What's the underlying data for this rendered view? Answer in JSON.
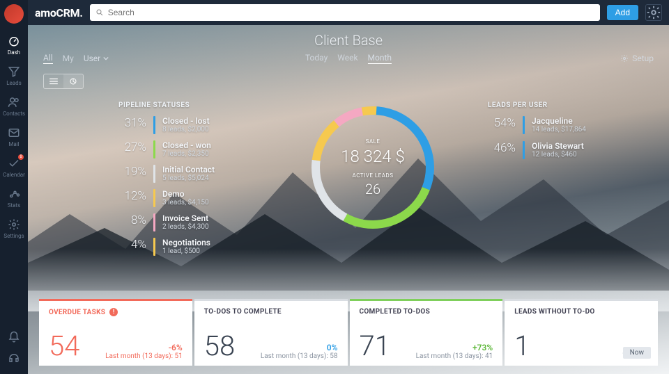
{
  "brand": "amoCRM.",
  "search_placeholder": "Search",
  "add_label": "Add",
  "page_title": "Client Base",
  "nav": [
    {
      "label": "Dash"
    },
    {
      "label": "Leads"
    },
    {
      "label": "Contacts"
    },
    {
      "label": "Mail"
    },
    {
      "label": "Calendar"
    },
    {
      "label": "Stats"
    },
    {
      "label": "Settings"
    }
  ],
  "filters_left": {
    "all": "All",
    "my": "My",
    "user": "User"
  },
  "filters_center": {
    "today": "Today",
    "week": "Week",
    "month": "Month"
  },
  "setup_label": "Setup",
  "pipeline_title": "PIPELINE STATUSES",
  "pipeline": [
    {
      "pct": "31%",
      "name": "Closed - lost",
      "sub": "8 leads, $2,000",
      "color": "#2e9ee5"
    },
    {
      "pct": "27%",
      "name": "Closed - won",
      "sub": "7 leads, $2,350",
      "color": "#8cd94b"
    },
    {
      "pct": "19%",
      "name": "Initial Contact",
      "sub": "5 leads, $5,024",
      "color": "#e0e4e8"
    },
    {
      "pct": "12%",
      "name": "Demo",
      "sub": "3 leads, $4,150",
      "color": "#f6c94f"
    },
    {
      "pct": "8%",
      "name": "Invoice Sent",
      "sub": "2 leads, $4,300",
      "color": "#f5a8c2"
    },
    {
      "pct": "4%",
      "name": "Negotiations",
      "sub": "1 lead, $500",
      "color": "#f6c94f"
    }
  ],
  "center": {
    "sale_label": "SALE",
    "sale_value": "18 324 $",
    "active_label": "ACTIVE LEADS",
    "active_value": "26"
  },
  "leads_title": "LEADS PER USER",
  "leads_users": [
    {
      "pct": "54%",
      "name": "Jacqueline",
      "sub": "14 leads, $17,864"
    },
    {
      "pct": "46%",
      "name": "Olivia Stewart",
      "sub": "12 leads, $460"
    }
  ],
  "cards": [
    {
      "title": "OVERDUE TASKS",
      "big": "54",
      "delta": "-6%",
      "sub": "Last month (13 days): 51"
    },
    {
      "title": "TO-DOS TO COMPLETE",
      "big": "58",
      "delta": "0%",
      "sub": "Last month (13 days): 58"
    },
    {
      "title": "COMPLETED TO-DOS",
      "big": "71",
      "delta": "+73%",
      "sub": "Last month (13 days): 41"
    },
    {
      "title": "LEADS WITHOUT TO-DO",
      "big": "1",
      "now": "Now"
    }
  ],
  "chart_data": {
    "type": "pie",
    "title": "Pipeline Statuses",
    "series": [
      {
        "name": "Closed - lost",
        "value": 31,
        "color": "#2e9ee5"
      },
      {
        "name": "Closed - won",
        "value": 27,
        "color": "#8cd94b"
      },
      {
        "name": "Initial Contact",
        "value": 19,
        "color": "#e0e4e8"
      },
      {
        "name": "Demo",
        "value": 12,
        "color": "#f6c94f"
      },
      {
        "name": "Invoice Sent",
        "value": 8,
        "color": "#f5a8c2"
      },
      {
        "name": "Negotiations",
        "value": 4,
        "color": "#f6c94f"
      }
    ],
    "center": {
      "sale": 18324,
      "currency": "$",
      "active_leads": 26
    }
  }
}
